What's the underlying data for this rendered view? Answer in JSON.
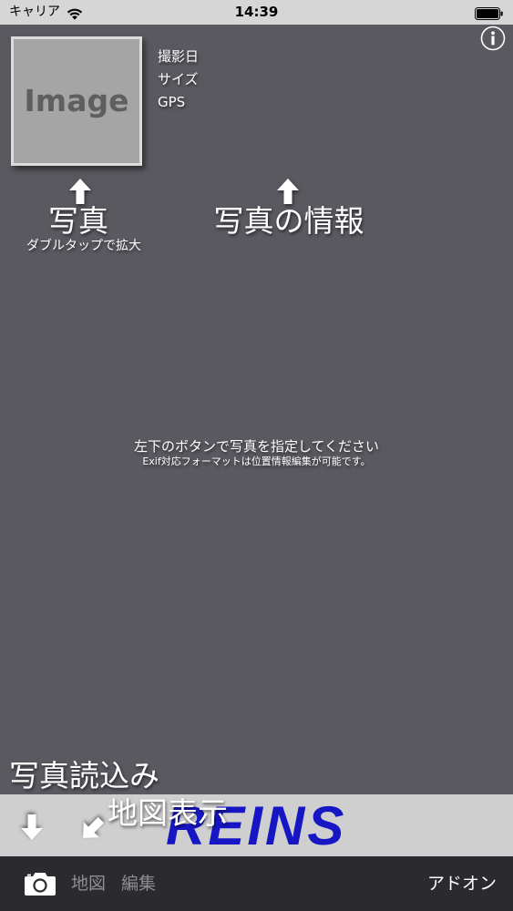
{
  "status_bar": {
    "carrier": "キャリア",
    "time": "14:39",
    "wifi_icon": "wifi-icon",
    "battery_icon": "battery-icon"
  },
  "header": {
    "info_icon": "info-icon"
  },
  "photo_preview": {
    "placeholder_text": "Image",
    "info_labels": [
      "撮影日",
      "サイズ",
      "GPS"
    ]
  },
  "hints": {
    "arrow_icon": "arrow-up-icon",
    "photo_title": "写真",
    "photo_subtitle": "ダブルタップで拡大",
    "info_title": "写真の情報"
  },
  "empty_state": {
    "message": "左下のボタンで写真を指定してください",
    "note": "Exif対応フォーマットは位置情報編集が可能です。"
  },
  "bottom_hints": {
    "load_photo": "写真読込み",
    "show_map": "地図表示",
    "down_arrow_icon": "arrow-down-icon",
    "diagonal_arrow_icon": "arrow-down-left-icon"
  },
  "banner": {
    "logo_text": "REINS"
  },
  "toolbar": {
    "camera_icon": "camera-icon",
    "map_label": "地図",
    "edit_label": "編集",
    "addon_label": "アドオン"
  },
  "colors": {
    "background": "#5a5960",
    "status_bar": "#d6d6d6",
    "image_fill": "#a5a5a5",
    "image_text": "#5f5f5f",
    "band": "#cfcfcf",
    "logo": "#1616c4",
    "toolbar": "#2b2b2f",
    "disabled_text": "#8e8e93"
  }
}
